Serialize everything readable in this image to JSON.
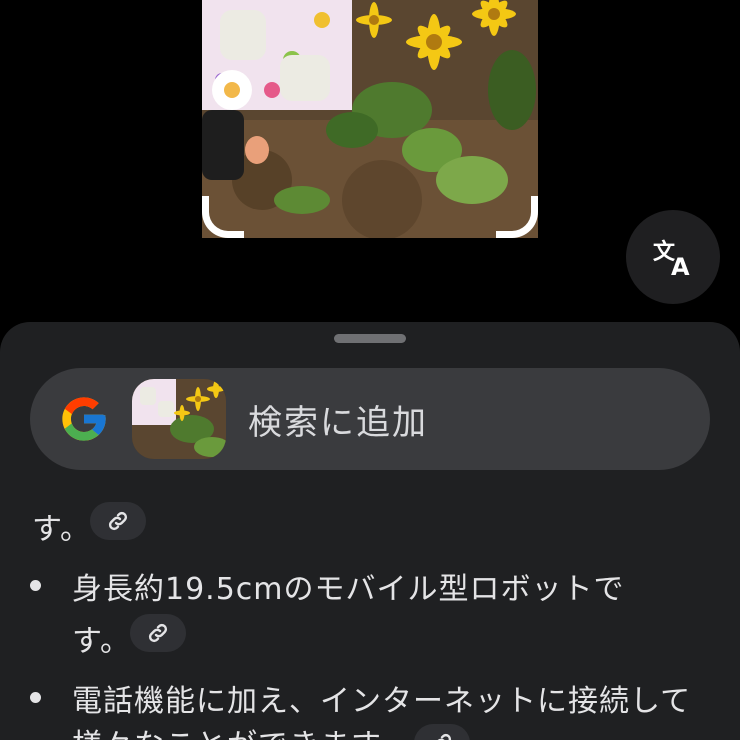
{
  "camera": {
    "translate_icon": "translate-icon"
  },
  "sheet": {
    "google_logo": "google-g-logo",
    "add_to_search_label": "検索に追加"
  },
  "answer": {
    "leading_fragment": "す。",
    "bullets": [
      {
        "lines": [
          "身長約19.5cmのモバイル型ロボットで",
          "す。"
        ]
      },
      {
        "lines": [
          "電話機能に加え、インターネットに接続して",
          "様々なことができます。"
        ]
      }
    ],
    "link_icon": "link-icon"
  },
  "colors": {
    "background": "#000000",
    "sheet": "#1f2022",
    "pill": "#3a3b3e",
    "text": "#e4e4e6"
  }
}
